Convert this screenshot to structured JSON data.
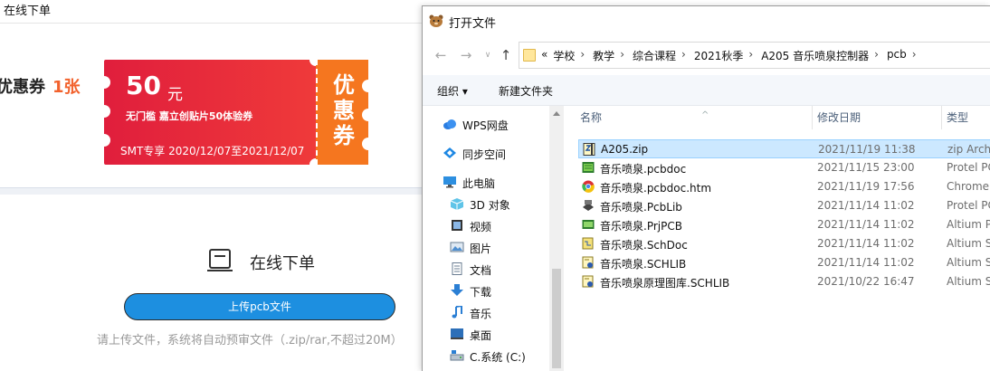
{
  "web": {
    "title": "在线下单",
    "coupon_caption": "优惠券",
    "coupon_count": "1张",
    "coupon": {
      "amount": "50",
      "unit": "元",
      "desc": "无门槛 嘉立创贴片50体验券",
      "period": "SMT专享 2020/12/07至2021/12/07",
      "side_label": "优惠券"
    },
    "upload_heading": "在线下单",
    "upload_button": "上传pcb文件",
    "upload_hint": "请上传文件，系统将自动预审文件（.zip/rar,不超过20M）",
    "colors": {
      "coupon_red": "#e01e3c",
      "coupon_orange": "#f5761f",
      "button_blue": "#1d8fe0",
      "count_orange": "#f2622d"
    }
  },
  "dialog": {
    "title": "打开文件",
    "breadcrumbs": [
      "«",
      "学校",
      "教学",
      "综合课程",
      "2021秋季",
      "A205 音乐喷泉控制器",
      "pcb"
    ],
    "toolbar": {
      "organize": "组织 ▾",
      "new_folder": "新建文件夹"
    },
    "nav_items": [
      {
        "label": "WPS网盘",
        "icon": "cloud-icon"
      },
      {
        "label": "同步空间",
        "icon": "sync-icon"
      },
      {
        "label": "此电脑",
        "icon": "computer-icon"
      },
      {
        "label": "3D 对象",
        "icon": "cube-icon"
      },
      {
        "label": "视频",
        "icon": "video-icon"
      },
      {
        "label": "图片",
        "icon": "picture-icon"
      },
      {
        "label": "文档",
        "icon": "document-icon"
      },
      {
        "label": "下载",
        "icon": "download-icon"
      },
      {
        "label": "音乐",
        "icon": "music-icon"
      },
      {
        "label": "桌面",
        "icon": "desktop-icon"
      },
      {
        "label": "C.系统 (C:)",
        "icon": "drive-icon"
      }
    ],
    "columns": {
      "name": "名称",
      "date": "修改日期",
      "type": "类型"
    },
    "files": [
      {
        "name": "A205.zip",
        "date": "2021/11/19 11:38",
        "type": "zip Archive",
        "icon": "zip-icon",
        "selected": true
      },
      {
        "name": "音乐喷泉.pcbdoc",
        "date": "2021/11/15 23:00",
        "type": "Protel PCB",
        "icon": "pcb-icon",
        "selected": false
      },
      {
        "name": "音乐喷泉.pcbdoc.htm",
        "date": "2021/11/19 17:56",
        "type": "Chrome HTML",
        "icon": "chrome-icon",
        "selected": false
      },
      {
        "name": "音乐喷泉.PcbLib",
        "date": "2021/11/14 11:02",
        "type": "Protel PCB",
        "icon": "pcblib-icon",
        "selected": false
      },
      {
        "name": "音乐喷泉.PrjPCB",
        "date": "2021/11/14 11:02",
        "type": "Altium PCB",
        "icon": "prjpcb-icon",
        "selected": false
      },
      {
        "name": "音乐喷泉.SchDoc",
        "date": "2021/11/14 11:02",
        "type": "Altium Sch",
        "icon": "schdoc-icon",
        "selected": false
      },
      {
        "name": "音乐喷泉.SCHLIB",
        "date": "2021/11/14 11:02",
        "type": "Altium Sch",
        "icon": "schlib-icon",
        "selected": false
      },
      {
        "name": "音乐喷泉原理图库.SCHLIB",
        "date": "2021/10/22 16:47",
        "type": "Altium Sch",
        "icon": "schlib-icon",
        "selected": false
      }
    ]
  }
}
